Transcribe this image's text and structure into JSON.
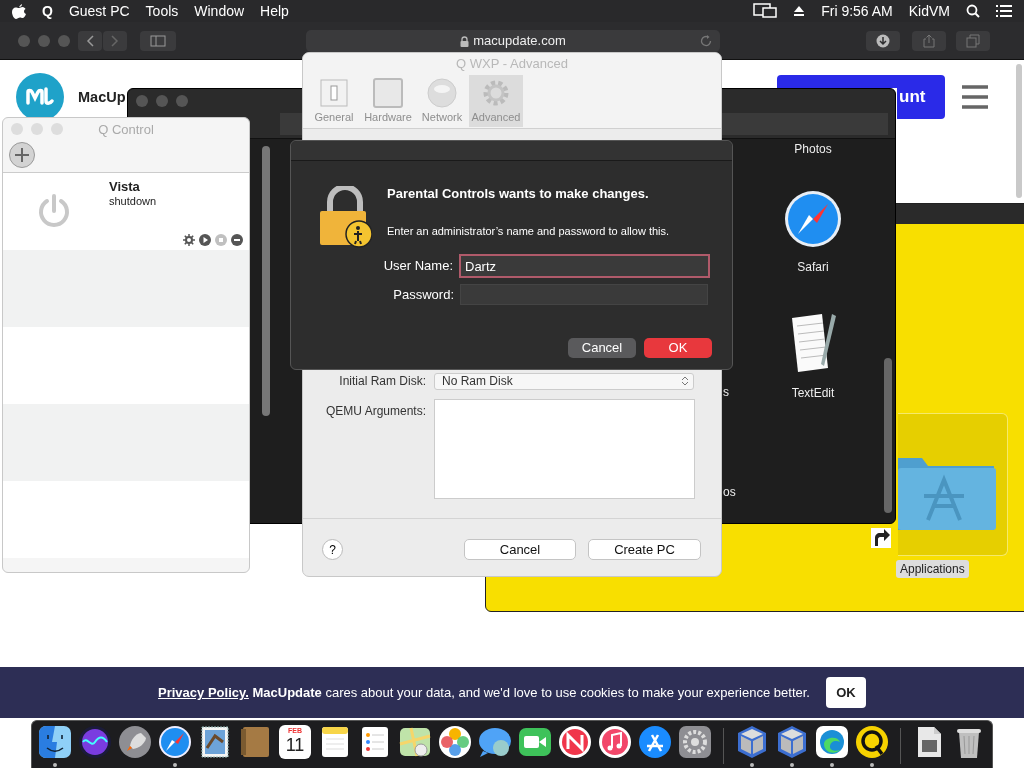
{
  "menu_bar": {
    "app": "Q",
    "items": [
      "Guest PC",
      "Tools",
      "Window",
      "Help"
    ],
    "clock": "Fri 9:56 AM",
    "user": "KidVM"
  },
  "browser": {
    "address": "macupdate.com",
    "site_name": "MacUp",
    "account_button": "unt",
    "cookie_banner": {
      "link": "Privacy Policy.",
      "text": "**MacUpdate** cares about your data, and we'd love to use cookies to make your experience better.",
      "button": "OK"
    }
  },
  "launcher": {
    "apps": [
      {
        "label": "Photos",
        "kind": "photos"
      },
      {
        "label": "Safari",
        "kind": "safari"
      },
      {
        "label": "TextEdit",
        "kind": "textedit"
      }
    ],
    "cut_labels": [
      "s",
      "os"
    ]
  },
  "finder": {
    "items": [
      {
        "label": "Applications",
        "selected": true
      }
    ]
  },
  "q_control": {
    "title": "Q Control",
    "machines": [
      {
        "name": "Vista",
        "status": "shutdown",
        "running": false,
        "actions": [
          {
            "kind": "settings",
            "disabled": false
          },
          {
            "kind": "play",
            "disabled": false
          },
          {
            "kind": "stop",
            "disabled": true
          },
          {
            "kind": "delete",
            "disabled": false
          }
        ]
      }
    ]
  },
  "qwxp": {
    "title": "Q WXP - Advanced",
    "tabs": [
      {
        "label": "General",
        "kind": "general",
        "selected": false
      },
      {
        "label": "Hardware",
        "kind": "hardware",
        "selected": false
      },
      {
        "label": "Network",
        "kind": "network",
        "selected": false
      },
      {
        "label": "Advanced",
        "kind": "advanced",
        "selected": true
      }
    ],
    "ram_disk_label": "Initial Ram Disk:",
    "ram_disk_value": "No Ram Disk",
    "qemu_label": "QEMU Arguments:",
    "help": "?",
    "buttons": [
      "Cancel",
      "Create PC"
    ]
  },
  "auth": {
    "title": "Parental Controls wants to make changes.",
    "message": "Enter an administrator’s name and password to allow this.",
    "user_label": "User Name:",
    "user_value": "Dartz",
    "password_label": "Password:",
    "buttons": [
      {
        "label": "Cancel",
        "default": false
      },
      {
        "label": "OK",
        "default": true
      }
    ]
  },
  "dock": [
    {
      "kind": "finder",
      "running": true
    },
    {
      "kind": "siri",
      "running": false
    },
    {
      "kind": "launchpad",
      "running": false
    },
    {
      "kind": "safari",
      "running": true
    },
    {
      "kind": "stamp",
      "running": false
    },
    {
      "kind": "notebook",
      "running": false
    },
    {
      "kind": "calendar",
      "month": "FEB",
      "day": "11",
      "running": false
    },
    {
      "kind": "notes",
      "running": false
    },
    {
      "kind": "reminders",
      "running": false
    },
    {
      "kind": "maps",
      "running": false
    },
    {
      "kind": "photos",
      "running": false
    },
    {
      "kind": "messages",
      "running": false
    },
    {
      "kind": "facetime",
      "running": false
    },
    {
      "kind": "news",
      "running": false
    },
    {
      "kind": "music",
      "running": false
    },
    {
      "kind": "appstore",
      "running": false
    },
    {
      "kind": "settings",
      "running": false
    },
    {
      "kind": "separator"
    },
    {
      "kind": "cube",
      "running": true
    },
    {
      "kind": "cube",
      "running": true
    },
    {
      "kind": "edge",
      "running": true
    },
    {
      "kind": "ring",
      "running": true
    },
    {
      "kind": "separator"
    },
    {
      "kind": "document",
      "running": false
    },
    {
      "kind": "trash",
      "running": false
    }
  ]
}
